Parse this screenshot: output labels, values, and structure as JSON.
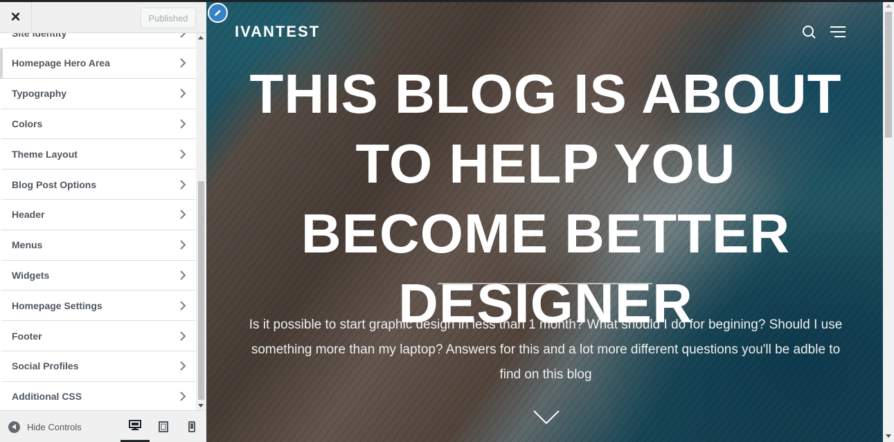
{
  "customizer": {
    "close_label": "×",
    "publish_label": "Published",
    "sections": [
      {
        "label": "Site Identity"
      },
      {
        "label": "Homepage Hero Area"
      },
      {
        "label": "Typography"
      },
      {
        "label": "Colors"
      },
      {
        "label": "Theme Layout"
      },
      {
        "label": "Blog Post Options"
      },
      {
        "label": "Header"
      },
      {
        "label": "Menus"
      },
      {
        "label": "Widgets"
      },
      {
        "label": "Homepage Settings"
      },
      {
        "label": "Footer"
      },
      {
        "label": "Social Profiles"
      },
      {
        "label": "Additional CSS"
      }
    ],
    "footer": {
      "hide_controls_label": "Hide Controls",
      "devices": [
        "desktop-icon",
        "tablet-icon",
        "mobile-icon"
      ],
      "active_device": "desktop"
    }
  },
  "preview": {
    "site_title": "IVANTEST",
    "hero": {
      "title": "THIS BLOG IS ABOUT TO HELP YOU BECOME BETTER DESIGNER",
      "description": "Is it possible to start graphic design in less than 1 month? What should I do for begining? Should I use something more than my laptop? Answers for this and a lot more different questions you'll be adble to find on this blog"
    }
  },
  "colors": {
    "accent": "#3582c4",
    "sidebar_bg": "#f0f0f1",
    "label_text": "#50575e"
  }
}
